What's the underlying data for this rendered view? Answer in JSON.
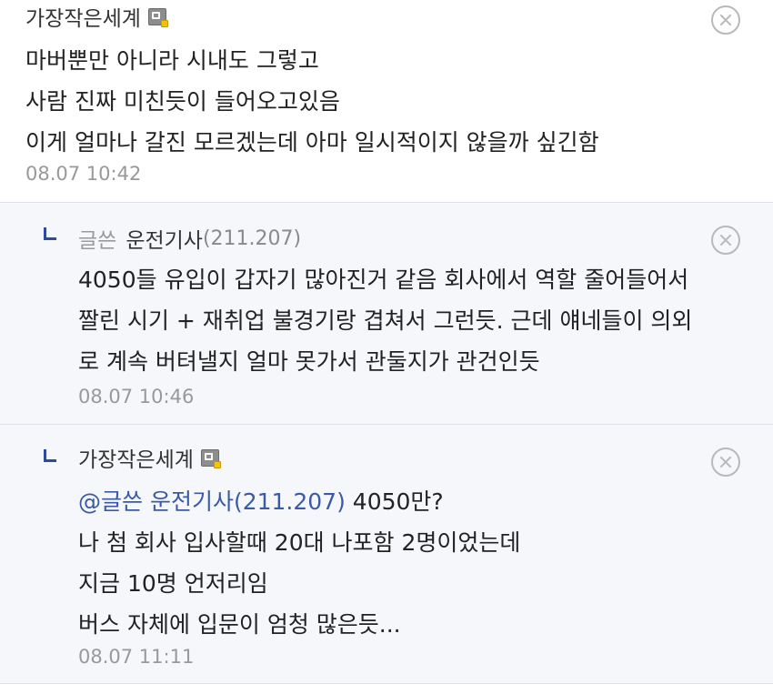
{
  "comments": [
    {
      "nickname": "가장작은세계",
      "lines": [
        "마버뿐만 아니라 시내도 그렇고",
        "사람 진짜 미친듯이 들어오고있음",
        "이게 얼마나 갈진 모르겠는데 아마 일시적이지 않을까 싶긴함"
      ],
      "date": "08.07 10:42"
    },
    {
      "prefix": "글쓴",
      "nickname": "운전기사",
      "ip": "(211.207)",
      "lines": [
        "4050들 유입이 갑자기 많아진거 같음 회사에서 역할 줄어들어서",
        "짤린 시기 + 재취업 불경기랑 겹쳐서 그런듯. 근데 얘네들이 의외",
        "로 계속 버텨낼지 얼마 못가서 관둘지가 관건인듯"
      ],
      "date": "08.07 10:46"
    },
    {
      "nickname": "가장작은세계",
      "mention": "@글쓴 운전기사(211.207)",
      "first_line_rest": " 4050만?",
      "lines": [
        "나 첨 회사 입사할때 20대 나포함 2명이었는데",
        "지금 10명 언저리임",
        "버스 자체에 입문이 엄청 많은듯..."
      ],
      "date": "08.07 11:11"
    }
  ],
  "colors": {
    "reply_background": "#f6f7fb",
    "mention": "#3a5aa6",
    "reply_marker": "#2f4a9a",
    "date": "#999999"
  },
  "icons": [
    "fixed-nickname-icon",
    "delete-comment-icon",
    "reply-marker-icon"
  ]
}
